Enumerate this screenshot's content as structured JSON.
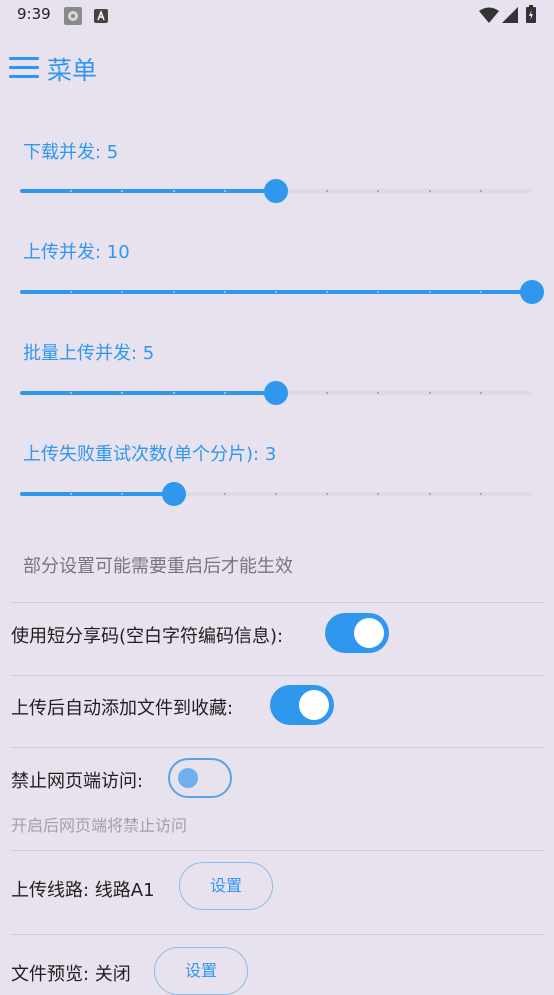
{
  "status_bar": {
    "time": "9:39"
  },
  "app_bar": {
    "title": "菜单"
  },
  "sliders": [
    {
      "label": "下载并发: 5",
      "value": 5,
      "max": 10
    },
    {
      "label": "上传并发: 10",
      "value": 10,
      "max": 10
    },
    {
      "label": "批量上传并发: 5",
      "value": 5,
      "max": 10
    },
    {
      "label": "上传失败重试次数(单个分片): 3",
      "value": 3,
      "max": 10
    }
  ],
  "hint": "部分设置可能需要重启后才能生效",
  "toggles": {
    "short_share": {
      "label": "使用短分享码(空白字符编码信息):",
      "on": true
    },
    "auto_favorite": {
      "label": "上传后自动添加文件到收藏:",
      "on": true
    },
    "disable_web": {
      "label": "禁止网页端访问:",
      "on": false,
      "sub_label": "开启后网页端将禁止访问"
    }
  },
  "upload_route": {
    "label": "上传线路: 线路A1",
    "button": "设置"
  },
  "file_preview": {
    "label": "文件预览: 关闭",
    "button": "设置"
  },
  "colors": {
    "accent": "#2f98ee",
    "background": "#e8e1ee",
    "track": "#dfd8e6"
  }
}
